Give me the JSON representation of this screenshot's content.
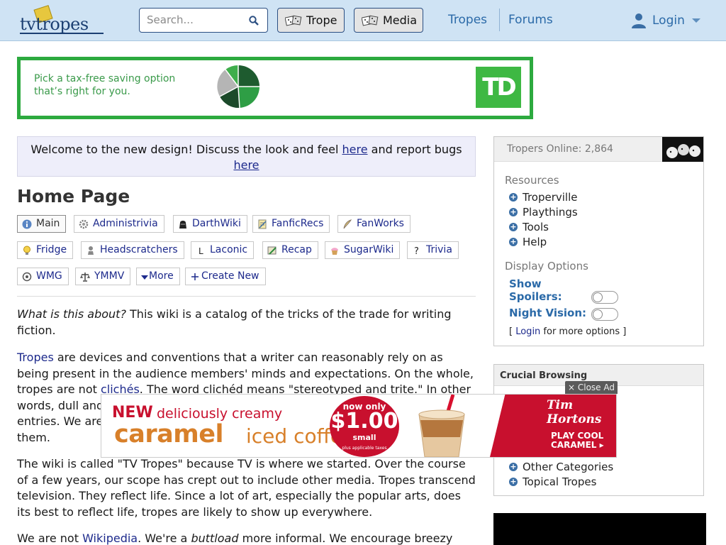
{
  "header": {
    "logo_text": "tvtropes",
    "search_placeholder": "Search...",
    "trope_button": "Trope",
    "media_button": "Media",
    "nav_tropes": "Tropes",
    "nav_forums": "Forums",
    "login": "Login"
  },
  "ad_top": {
    "line1": "Pick a tax-free saving option",
    "line2": "that’s right for you.",
    "logo": "TD"
  },
  "notice": {
    "before": "Welcome to the new design! Discuss the look and feel ",
    "link1": "here",
    "middle": " and report bugs ",
    "link2": "here"
  },
  "page_title": "Home Page",
  "tabs": [
    {
      "label": "Main",
      "icon": "info-icon"
    },
    {
      "label": "Administrivia",
      "icon": "gear-icon"
    },
    {
      "label": "DarthWiki",
      "icon": "darth-vader-icon"
    },
    {
      "label": "FanficRecs",
      "icon": "notepad-icon"
    },
    {
      "label": "FanWorks",
      "icon": "quill-icon"
    },
    {
      "label": "Fridge",
      "icon": "lightbulb-icon"
    },
    {
      "label": "Headscratchers",
      "icon": "thinker-icon"
    },
    {
      "label": "Laconic",
      "icon": "laconic-l-icon"
    },
    {
      "label": "Recap",
      "icon": "recap-icon"
    },
    {
      "label": "SugarWiki",
      "icon": "cupcake-icon"
    },
    {
      "label": "Trivia",
      "icon": "question-icon"
    },
    {
      "label": "WMG",
      "icon": "wmg-icon"
    },
    {
      "label": "YMMV",
      "icon": "scales-icon"
    },
    {
      "label": "More",
      "icon": "caret-down-icon"
    },
    {
      "label": "Create New",
      "icon": "plus-icon"
    }
  ],
  "paragraphs": {
    "p1_em": "What is this about?",
    "p1_rest": " This wiki is a catalog of the tricks of the trade for writing fiction.",
    "p2_link": "Tropes",
    "p2_a": " are devices and conventions that a writer can reasonably rely on as being present in the audience members' minds and expectations. On the whole, tropes are not ",
    "p2_cliche": "clichés",
    "p2_b": ". The word clichéd means \"stereotyped and trite.\" In other words, dull and ",
    "p2_c": "entries. We are ",
    "p2_d": "them.",
    "p3": "The wiki is called \"TV Tropes\" because TV is where we started. Over the course of a few years, our scope has crept out to include other media. Tropes transcend television. They reflect life. Since a lot of art, especially the popular arts, does its best to reflect life, tropes are likely to show up everywhere.",
    "p4_a": "We are not ",
    "p4_link": "Wikipedia",
    "p4_b": ". We're a ",
    "p4_em": "buttload",
    "p4_c": " more informal. We encourage breezy"
  },
  "sidebar": {
    "online": "Tropers Online: 2,864",
    "resources_label": "Resources",
    "resources": [
      "Troperville",
      "Playthings",
      "Tools",
      "Help"
    ],
    "display_label": "Display Options",
    "show_spoilers": "Show Spoilers:",
    "show_spoilers_line1": "Show",
    "show_spoilers_line2": "Spoilers:",
    "night_vision": "Night Vision:",
    "login_more_a": "[ ",
    "login_more_link": "Login",
    "login_more_b": " for more options ]",
    "crucial_title": "Crucial Browsing",
    "crucial_items": [
      "Other Categories",
      "Topical Tropes"
    ]
  },
  "ad_float": {
    "close": "× Close Ad",
    "new": "NEW",
    "sub": "deliciously creamy",
    "caramel": "caramel",
    "iced": "iced coffee",
    "now_only": "now only",
    "price": "$1.00",
    "size": "small",
    "tax": "plus applicable taxes",
    "brand": "Tim Hortons",
    "cta_line1": "PLAY COOL",
    "cta_line2": "CARAMEL ▸"
  },
  "colors": {
    "header_bg": "#cfe3f4",
    "link": "#1d2a8c",
    "td_green": "#3eb843",
    "timhortons_red": "#c8102e"
  }
}
